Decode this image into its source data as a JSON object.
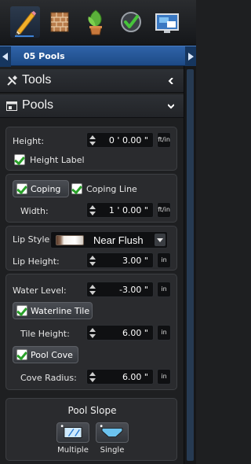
{
  "toolbar": {
    "icons": [
      "pencil-icon",
      "brick-wall-icon",
      "plant-icon",
      "checkmark-icon",
      "monitor-icon"
    ]
  },
  "breadcrumb": {
    "label": "05 Pools"
  },
  "tools_section": {
    "title": "Tools"
  },
  "pools_section": {
    "title": "Pools"
  },
  "height_panel": {
    "height_label": "Height:",
    "height_value": "0 ' 0.00 \"",
    "height_unit": "ft/in",
    "height_label_checkbox": "Height Label"
  },
  "coping_panel": {
    "coping_button": "Coping",
    "coping_line": "Coping Line",
    "width_label": "Width:",
    "width_value": "1 ' 0.00 \"",
    "width_unit": "ft/in"
  },
  "lip_panel": {
    "lip_style_label": "Lip Style:",
    "lip_style_value": "Near Flush",
    "lip_height_label": "Lip Height:",
    "lip_height_value": "3.00 \"",
    "lip_height_unit": "in"
  },
  "water_panel": {
    "water_level_label": "Water Level:",
    "water_level_value": "-3.00 \"",
    "water_level_unit": "in",
    "waterline_tile_button": "Waterline Tile",
    "tile_height_label": "Tile Height:",
    "tile_height_value": "6.00 \"",
    "tile_height_unit": "in",
    "pool_cove_button": "Pool Cove",
    "cove_radius_label": "Cove Radius:",
    "cove_radius_value": "6.00 \"",
    "cove_radius_unit": "in"
  },
  "slope_panel": {
    "title": "Pool Slope",
    "multiple_label": "Multiple",
    "single_label": "Single"
  },
  "colors": {
    "accent_blue": "#2f63a8",
    "check_green": "#2aa12a",
    "background": "#1e1f21"
  }
}
